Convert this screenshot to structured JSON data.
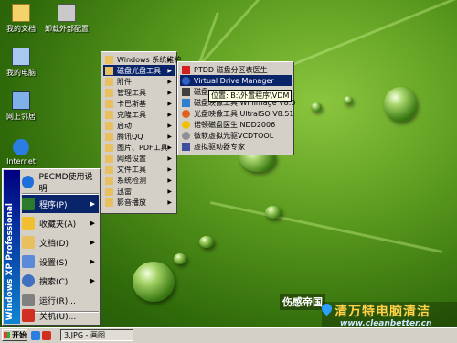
{
  "desktop_icons": [
    {
      "label": "我的文档",
      "icon": "my-documents-icon",
      "color": "#f3d36a"
    },
    {
      "label": "卸载外部配置",
      "icon": "uninstall-icon",
      "color": "#c9c9c9"
    },
    {
      "label": "我的电脑",
      "icon": "my-computer-icon",
      "color": "#a8c8f0"
    },
    {
      "label": "网上邻居",
      "icon": "network-icon",
      "color": "#7fb0e8"
    },
    {
      "label": "Internet",
      "icon": "internet-explorer-icon",
      "color": "#2a7de1"
    }
  ],
  "start_menu": {
    "sidebar_text": "Windows XP Professional",
    "items": [
      {
        "label": "PECMD使用说明",
        "icon": "help-icon",
        "color": "#1e6fd9"
      },
      {
        "label": "程序(P)",
        "icon": "programs-icon",
        "color": "#2c7a2c",
        "submenu": true,
        "highlight": true
      },
      {
        "label": "收藏夹(A)",
        "icon": "favorites-icon",
        "color": "#f0c030",
        "submenu": true
      },
      {
        "label": "文档(D)",
        "icon": "documents-icon",
        "color": "#e8c060",
        "submenu": true
      },
      {
        "label": "设置(S)",
        "icon": "settings-icon",
        "color": "#5a8ad8",
        "submenu": true
      },
      {
        "label": "搜索(C)",
        "icon": "search-icon",
        "color": "#4070c0",
        "submenu": true
      },
      {
        "label": "运行(R)...",
        "icon": "run-icon",
        "color": "#808080"
      },
      {
        "label": "关机(U)...",
        "icon": "shutdown-icon",
        "color": "#d03020"
      }
    ]
  },
  "programs_menu": {
    "items": [
      {
        "label": "Windows 系统维护",
        "submenu": true
      },
      {
        "label": "磁盘光盘工具",
        "submenu": true,
        "highlight": true
      },
      {
        "label": "附件",
        "submenu": true
      },
      {
        "label": "管理工具",
        "submenu": true
      },
      {
        "label": "卡巴斯基",
        "submenu": true
      },
      {
        "label": "克隆工具",
        "submenu": true
      },
      {
        "label": "启动",
        "submenu": true
      },
      {
        "label": "腾讯QQ",
        "submenu": true
      },
      {
        "label": "图片、PDF工具",
        "submenu": true
      },
      {
        "label": "网络设置",
        "submenu": true
      },
      {
        "label": "文件工具",
        "submenu": true
      },
      {
        "label": "系统检测",
        "submenu": true
      },
      {
        "label": "迅雷",
        "submenu": true
      },
      {
        "label": "影音播放",
        "submenu": true
      }
    ]
  },
  "disk_menu": {
    "items": [
      {
        "label": "PTDD 磁盘分区表医生",
        "icon": "ptdd-icon",
        "color": "#d02020"
      },
      {
        "label": "Virtual Drive Manager",
        "icon": "virtual-drive-icon",
        "color": "#3060c0",
        "highlight": true
      },
      {
        "label": "磁盘",
        "icon": "disk-icon",
        "color": "#404040"
      },
      {
        "label": "磁盘映像工具 WinImage V8.0",
        "icon": "winimage-icon",
        "color": "#3080d0"
      },
      {
        "label": "光盘映像工具 UltraISO V8.51",
        "icon": "ultraiso-icon",
        "color": "#e06020"
      },
      {
        "label": "诺顿磁盘医生 NDD2006",
        "icon": "norton-icon",
        "color": "#f0c000"
      },
      {
        "label": "微软虚拟光驱VCDTOOL",
        "icon": "vcdtool-icon",
        "color": "#909090"
      },
      {
        "label": "虚拟驱动器专家",
        "icon": "virtual-expert-icon",
        "color": "#4050a0"
      }
    ]
  },
  "tooltip": "位置: B:\\外置程序\\VDM",
  "taskbar": {
    "start_label": "开始",
    "window_button": "3.JPG - 画图"
  },
  "watermark": {
    "line1": "伤感帝国",
    "line2": "清万特电脑清洁",
    "line3": "www.cleanbetter.cn"
  }
}
